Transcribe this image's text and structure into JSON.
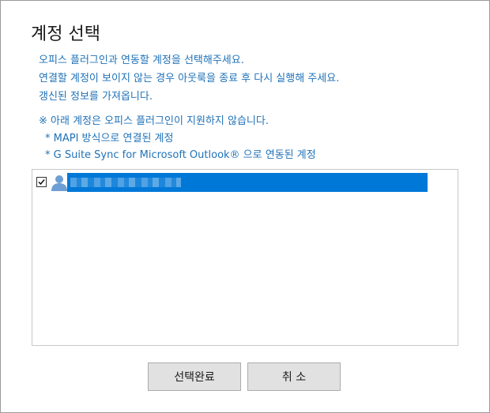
{
  "dialog": {
    "title": "계정 선택",
    "description": [
      "오피스 플러그인과 연동할 계정을 선택해주세요.",
      "연결할 계정이 보이지 않는 경우 아웃룩을 종료 후 다시 실행해 주세요.",
      "갱신된 정보를 가져옵니다."
    ],
    "notice": {
      "heading": "※ 아래 계정은 오피스 플러그인이 지원하지 않습니다.",
      "items": [
        "* MAPI 방식으로 연결된 계정",
        "* G Suite Sync for Microsoft Outlook® 으로 연동된 계정"
      ]
    },
    "accounts": [
      {
        "checked": true,
        "selected": true,
        "label": ""
      }
    ],
    "buttons": {
      "confirm": "선택완료",
      "cancel": "취 소"
    }
  },
  "colors": {
    "info_text": "#1f72b8",
    "selection": "#0078d7",
    "button_bg": "#e1e1e1"
  },
  "icons": {
    "account": "user-icon",
    "check": "checkbox-checked-icon"
  }
}
